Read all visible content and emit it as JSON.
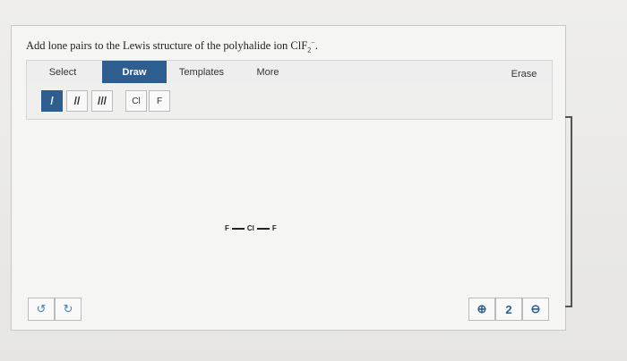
{
  "question": {
    "prefix": "Add lone pairs to the Lewis structure of the polyhalide ion ",
    "ion_base": "ClF",
    "ion_charge": "−",
    "ion_count": "2",
    "suffix": "."
  },
  "tabs": {
    "select": "Select",
    "draw": "Draw",
    "templates": "Templates",
    "more": "More",
    "erase": "Erase"
  },
  "bond_tools": [
    {
      "label": "/"
    },
    {
      "label": "//"
    },
    {
      "label": "///"
    }
  ],
  "atom_tools": [
    {
      "label": "Cl"
    },
    {
      "label": "F"
    }
  ],
  "molecule": {
    "left_atom": "F",
    "center_atom": "Cl",
    "right_atom": "F"
  },
  "icons": {
    "undo": "↺",
    "redo": "↻",
    "zoom_in": "⊕",
    "zoom_reset": "2",
    "zoom_out": "⊖"
  }
}
